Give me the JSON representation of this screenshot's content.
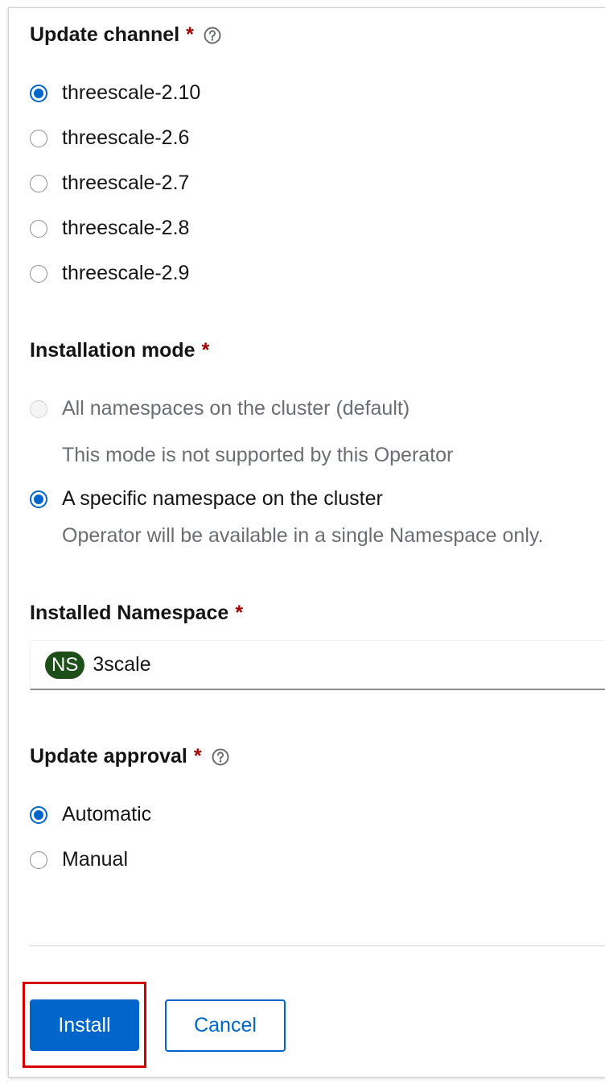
{
  "update_channel": {
    "label": "Update channel",
    "required_mark": "*",
    "options": [
      {
        "label": "threescale-2.10",
        "checked": true
      },
      {
        "label": "threescale-2.6",
        "checked": false
      },
      {
        "label": "threescale-2.7",
        "checked": false
      },
      {
        "label": "threescale-2.8",
        "checked": false
      },
      {
        "label": "threescale-2.9",
        "checked": false
      }
    ]
  },
  "installation_mode": {
    "label": "Installation mode",
    "required_mark": "*",
    "options": [
      {
        "label": "All namespaces on the cluster (default)",
        "description": "This mode is not supported by this Operator",
        "checked": false,
        "disabled": true
      },
      {
        "label": "A specific namespace on the cluster",
        "description": "Operator will be available in a single Namespace only.",
        "checked": true,
        "disabled": false
      }
    ]
  },
  "installed_namespace": {
    "label": "Installed Namespace",
    "required_mark": "*",
    "badge": "NS",
    "value": "3scale"
  },
  "update_approval": {
    "label": "Update approval",
    "required_mark": "*",
    "options": [
      {
        "label": "Automatic",
        "checked": true
      },
      {
        "label": "Manual",
        "checked": false
      }
    ]
  },
  "actions": {
    "install_label": "Install",
    "cancel_label": "Cancel"
  },
  "icons": {
    "help": "question-circle-icon"
  },
  "colors": {
    "primary": "#0066cc",
    "required": "#a30000",
    "namespace_badge": "#1e4f18",
    "highlight": "#d40000"
  }
}
